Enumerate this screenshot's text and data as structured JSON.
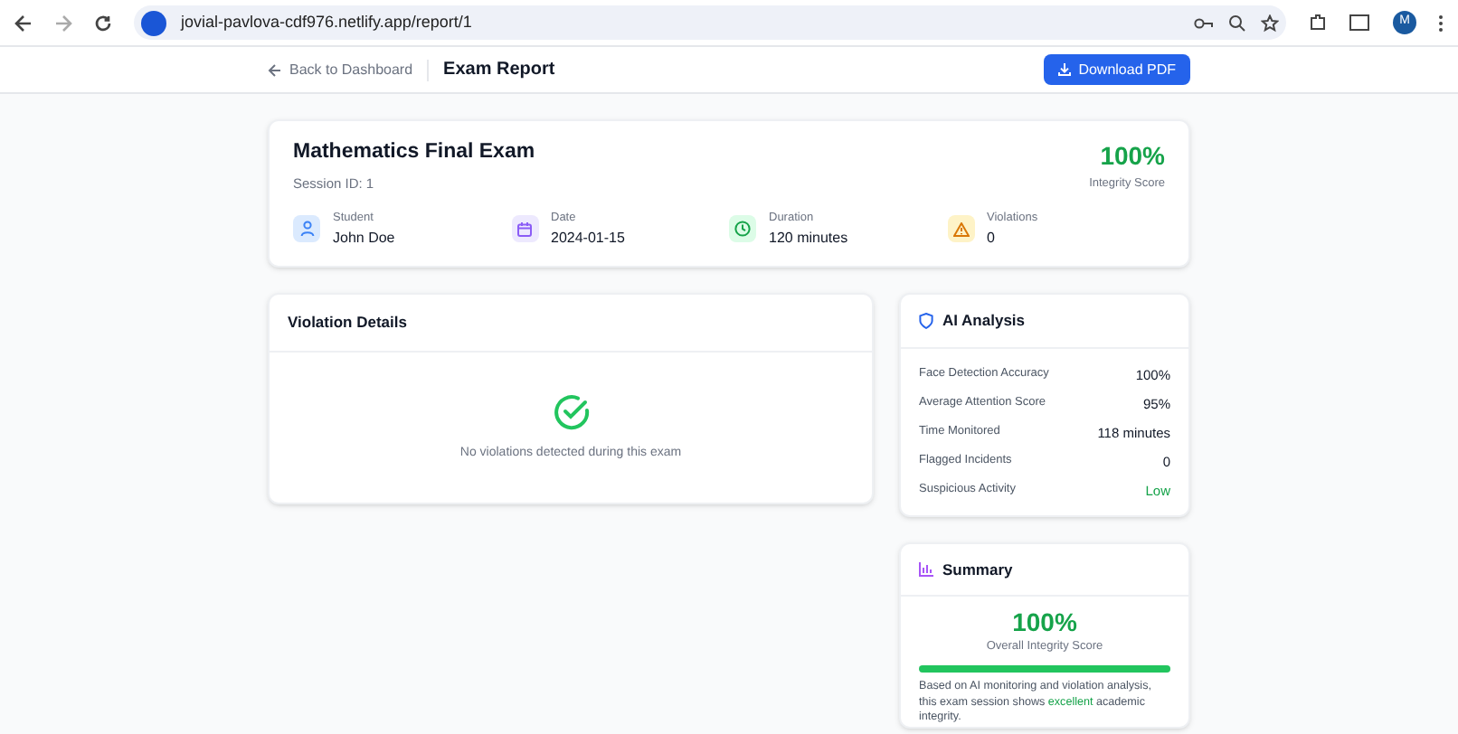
{
  "browser": {
    "url": "jovial-pavlova-cdf976.netlify.app/report/1",
    "profile_initial": "M"
  },
  "header": {
    "back_link": "Back to Dashboard",
    "title": "Exam Report",
    "download_button": "Download PDF"
  },
  "exam": {
    "title": "Mathematics Final Exam",
    "session": "Session ID: 1",
    "score": "100%",
    "score_label": "Integrity Score",
    "facts": [
      {
        "kind": "student",
        "label": "Student",
        "value": "John Doe"
      },
      {
        "kind": "date",
        "label": "Date",
        "value": "2024-01-15"
      },
      {
        "kind": "duration",
        "label": "Duration",
        "value": "120 minutes"
      },
      {
        "kind": "violations",
        "label": "Violations",
        "value": "0"
      }
    ]
  },
  "violations": {
    "title": "Violation Details",
    "empty_message": "No violations detected during this exam"
  },
  "ai_analysis": {
    "title": "AI Analysis",
    "rows": [
      {
        "label": "Face Detection Accuracy",
        "value": "100%",
        "positive": false
      },
      {
        "label": "Average Attention Score",
        "value": "95%",
        "positive": false
      },
      {
        "label": "Time Monitored",
        "value": "118 minutes",
        "positive": false
      },
      {
        "label": "Flagged Incidents",
        "value": "0",
        "positive": false
      },
      {
        "label": "Suspicious Activity",
        "value": "Low",
        "positive": true
      }
    ]
  },
  "summary": {
    "title": "Summary",
    "score": "100%",
    "score_label": "Overall Integrity Score",
    "level": 1,
    "text_before": "Based on AI monitoring and violation analysis, this exam session shows",
    "highlight": "excellent",
    "text_after": "academic integrity."
  }
}
